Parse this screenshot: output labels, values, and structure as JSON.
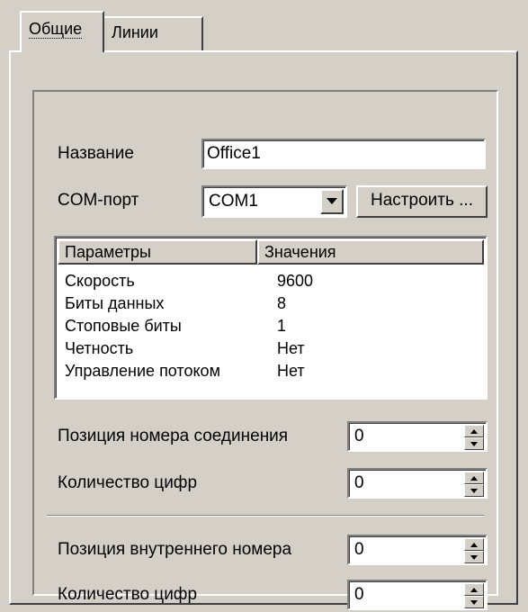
{
  "tabs": {
    "general": "Общие",
    "lines": "Линии"
  },
  "fields": {
    "name_label": "Название",
    "name_value": "Office1",
    "com_label": "COM-порт",
    "com_value": "COM1",
    "configure_button": "Настроить ..."
  },
  "params_table": {
    "headers": [
      "Параметры",
      "Значения"
    ],
    "rows": [
      [
        "Скорость",
        "9600"
      ],
      [
        "Биты данных",
        "8"
      ],
      [
        "Стоповые биты",
        "1"
      ],
      [
        "Четность",
        "Нет"
      ],
      [
        "Управление потоком",
        "Нет"
      ]
    ]
  },
  "connection": {
    "position_label": "Позиция номера соединения",
    "position_value": "0",
    "digits_label": "Количество цифр",
    "digits_value": "0"
  },
  "internal": {
    "position_label": "Позиция внутреннего номера",
    "position_value": "0",
    "digits_label": "Количество цифр",
    "digits_value": "0"
  },
  "icons": {
    "dropdown": "chevron-down-icon",
    "spin_up": "spin-up-icon",
    "spin_down": "spin-down-icon"
  }
}
